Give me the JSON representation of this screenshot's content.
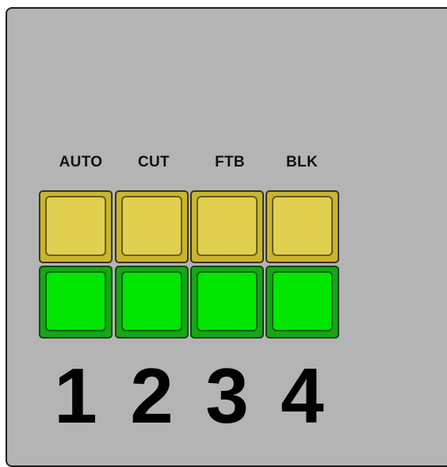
{
  "transition_labels": [
    "AUTO",
    "CUT",
    "FTB",
    "BLK"
  ],
  "input_numbers": [
    "1",
    "2",
    "3",
    "4"
  ],
  "colors": {
    "panel_bg": "#b4b4b4",
    "transition_button": "#e1cf4f",
    "input_button": "#00e600"
  }
}
